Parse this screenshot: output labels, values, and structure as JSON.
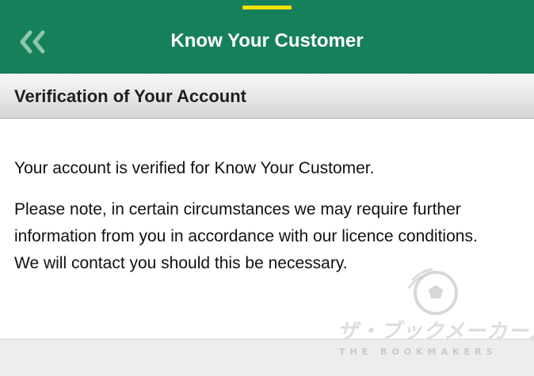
{
  "header": {
    "title": "Know Your Customer",
    "back_icon": "double-chevron-left-icon",
    "background_color": "#16805a",
    "indicator_color": "#f2e000"
  },
  "section": {
    "title": "Verification of Your Account"
  },
  "content": {
    "paragraph_1": "Your account is verified for Know Your Customer.",
    "paragraph_2": "Please note, in certain circumstances we may require further information from you in accordance with our licence conditions. We will contact you should this be necessary."
  },
  "watermark": {
    "japanese": "ザ・ブックメーカーズ",
    "english": "THE BOOKMAKERS"
  }
}
